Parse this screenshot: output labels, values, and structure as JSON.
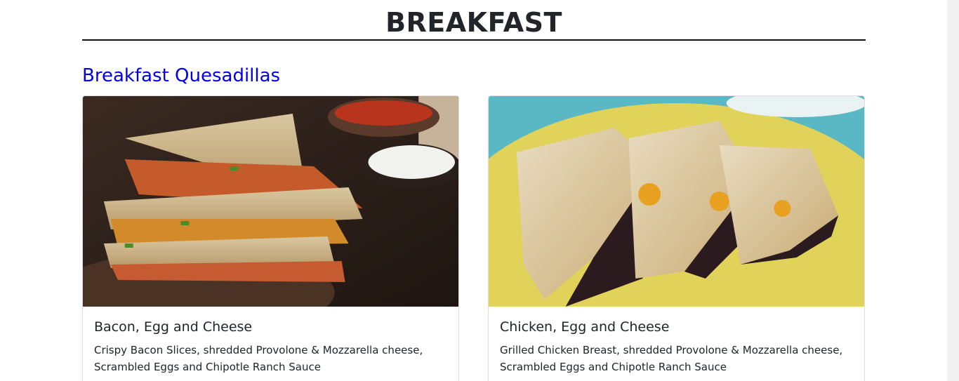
{
  "section": {
    "title": "BREAKFAST"
  },
  "category": {
    "title": "Breakfast Quesadillas"
  },
  "cards": [
    {
      "image": "bacon-quesadilla-photo",
      "title": "Bacon, Egg and Cheese",
      "description": "Crispy Bacon Slices, shredded Provolone & Mozzarella cheese, Scrambled Eggs and Chipotle Ranch Sauce"
    },
    {
      "image": "chicken-quesadilla-photo",
      "title": "Chicken, Egg and Cheese",
      "description": "Grilled Chicken Breast, shredded Provolone & Mozzarella cheese, Scrambled Eggs and Chipotle Ranch Sauce"
    }
  ],
  "colors": {
    "link": "#0000ee",
    "heading": "#212529",
    "divider": "#111111"
  }
}
